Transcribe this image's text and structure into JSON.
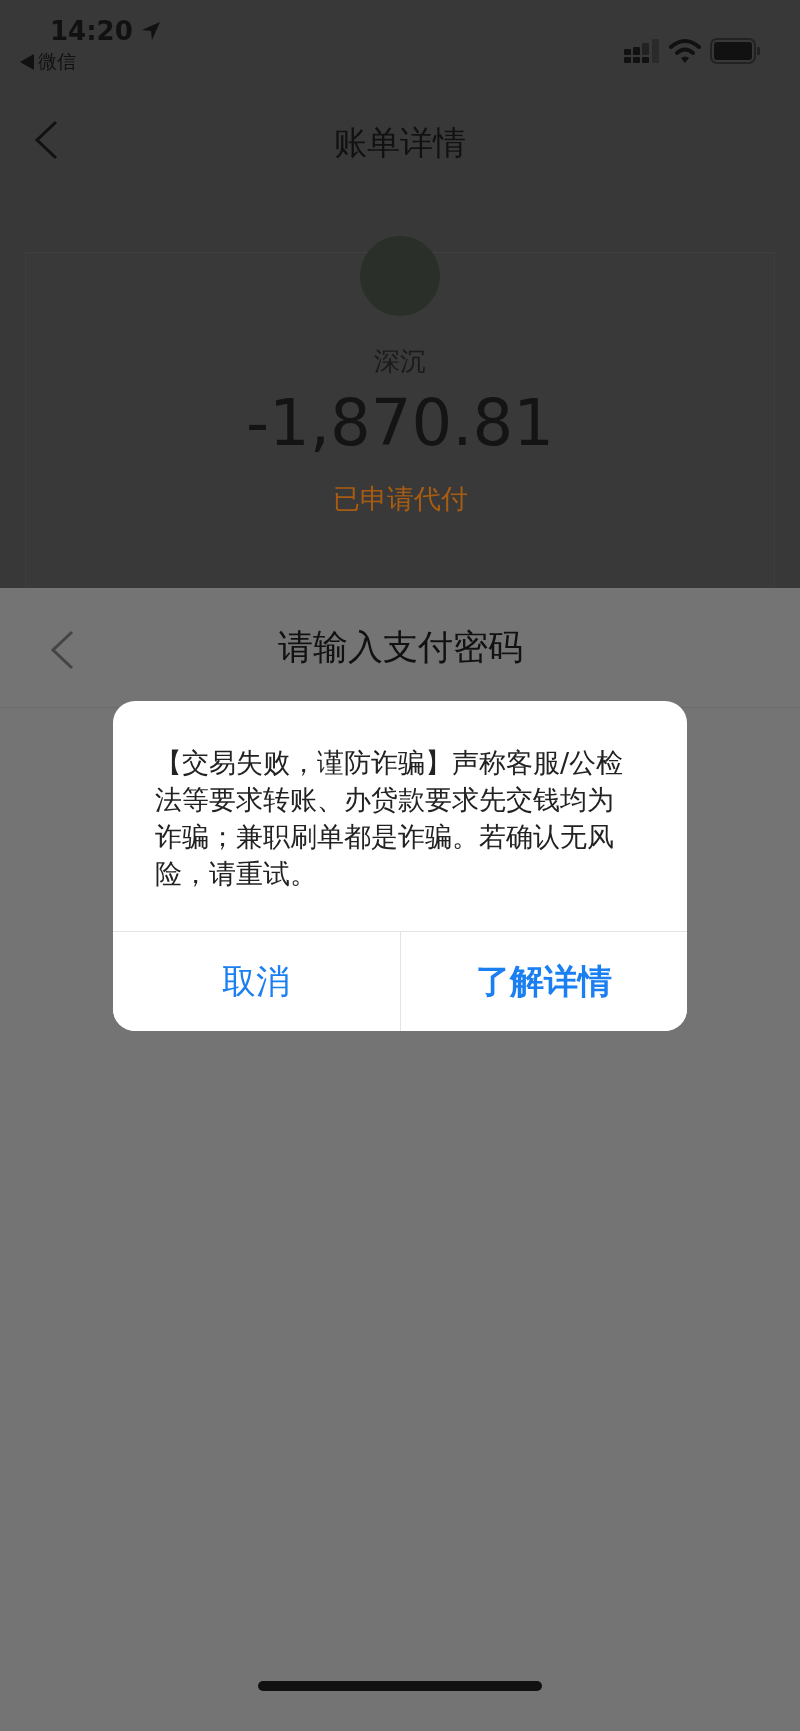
{
  "status_bar": {
    "time": "14:20",
    "back_app": "微信"
  },
  "nav": {
    "title": "账单详情"
  },
  "bill": {
    "name": "深沉",
    "amount": "-1,870.81",
    "status": "已申请代付"
  },
  "password_sheet": {
    "title": "请输入支付密码"
  },
  "alert": {
    "message": "【交易失败，谨防诈骗】声称客服/公检法等要求转账、办贷款要求先交钱均为诈骗；兼职刷单都是诈骗。若确认无风险，请重试。",
    "buttons": [
      {
        "label": "取消",
        "kind": "cancel"
      },
      {
        "label": "了解详情",
        "kind": "primary"
      }
    ]
  }
}
